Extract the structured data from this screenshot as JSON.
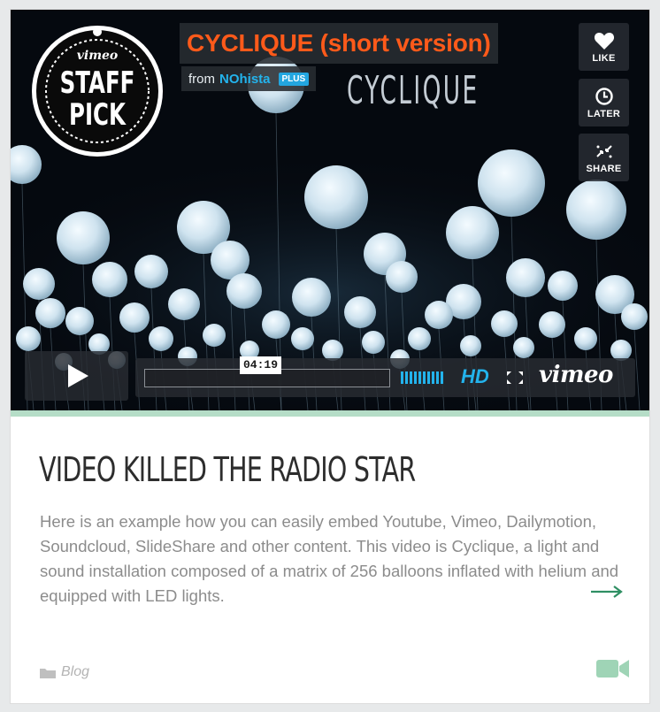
{
  "video": {
    "title": "CYCLIQUE (short version)",
    "byline_prefix": "from",
    "author": "NOhista",
    "badge": "PLUS",
    "logo_text": "CYCLIQUE",
    "staff_pick": {
      "brand": "vimeo",
      "line1": "STAFF",
      "line2": "PICK"
    },
    "side_buttons": [
      {
        "label": "LIKE",
        "icon": "heart-icon"
      },
      {
        "label": "LATER",
        "icon": "clock-icon"
      },
      {
        "label": "SHARE",
        "icon": "share-icon"
      }
    ],
    "player": {
      "time": "04:19",
      "hd_label": "HD",
      "brand_label": "vimeo"
    },
    "colors": {
      "title": "#ff5a1a",
      "accent": "#23b3ec",
      "player_bg": "#282c32"
    }
  },
  "post": {
    "heading": "VIDEO KILLED THE RADIO STAR",
    "excerpt": "Here is an example how you can easily embed Youtube, Vimeo, Dailymotion, Soundcloud, SlideShare and other content. This video is Cyclique, a light and sound installation composed of a matrix of 256 balloons inflated with helium and equipped with LED lights.",
    "category": "Blog",
    "format_icon": "video-camera-icon",
    "accent": "#9fd4b6"
  }
}
